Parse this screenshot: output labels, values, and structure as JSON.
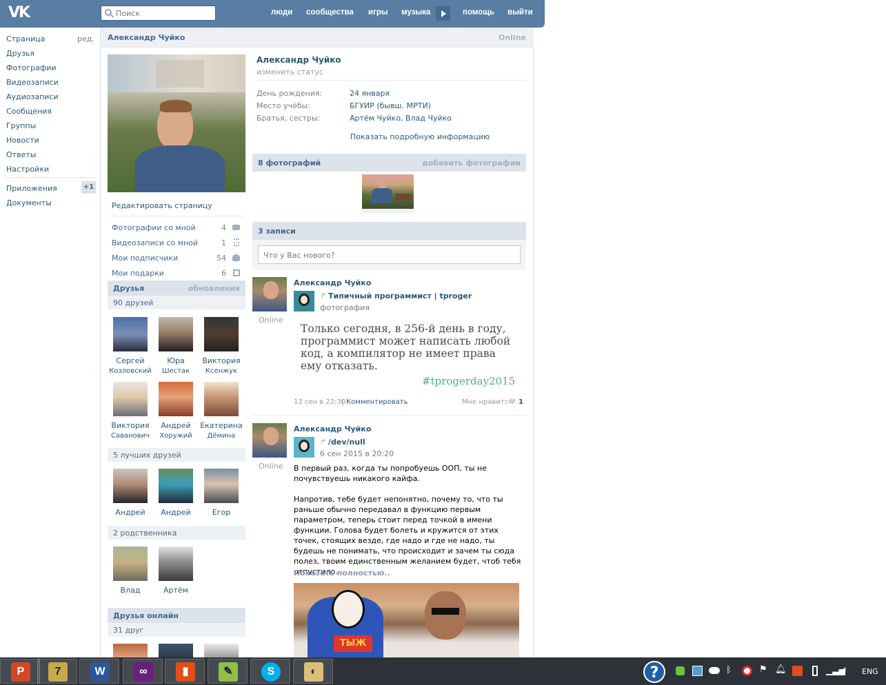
{
  "topbar": {
    "logo": "VK",
    "search_placeholder": "Поиск",
    "nav": [
      "люди",
      "сообщества",
      "игры",
      "музыка",
      "помощь",
      "выйти"
    ]
  },
  "leftnav": {
    "items": [
      "Страница",
      "Друзья",
      "Фотографии",
      "Видеозаписи",
      "Аудиозаписи",
      "Сообщения",
      "Группы",
      "Новости",
      "Ответы",
      "Настройки"
    ],
    "edit": "ред.",
    "apps": "Приложения",
    "apps_badge": "+1",
    "docs": "Документы"
  },
  "profile": {
    "header_name": "Александр Чуйко",
    "header_status": "Online",
    "name": "Александр Чуйко",
    "change_status": "изменить статус",
    "info": [
      {
        "label": "День рождения:",
        "value": "24 января"
      },
      {
        "label": "Место учёбы:",
        "value": "БГУИР (бывш. МРТИ)"
      },
      {
        "label": "Братья, сестры:",
        "value": "Артём Чуйко, Влад Чуйко"
      }
    ],
    "show_more": "Показать подробную информацию",
    "edit_page": "Редактировать страницу",
    "counters": [
      {
        "label": "Фотографии со мной",
        "count": "4",
        "icon": "camera-icon"
      },
      {
        "label": "Видеозаписи со мной",
        "count": "1",
        "icon": "film-icon"
      },
      {
        "label": "Мои подписчики",
        "count": "54",
        "icon": "people-icon"
      },
      {
        "label": "Мои подарки",
        "count": "6",
        "icon": "gift-icon"
      }
    ]
  },
  "friends": {
    "title": "Друзья",
    "updates": "обновления",
    "count": "90 друзей",
    "list": [
      {
        "first": "Сергей",
        "last": "Козловский"
      },
      {
        "first": "Юра",
        "last": "Шестак"
      },
      {
        "first": "Виктория",
        "last": "Ксенжук"
      },
      {
        "first": "Виктория",
        "last": "Саванович"
      },
      {
        "first": "Андрей",
        "last": "Хоружий"
      },
      {
        "first": "Екатерина",
        "last": "Дёмина"
      }
    ],
    "best_count": "5 лучших друзей",
    "best": [
      "Андрей",
      "Андрей",
      "Егор"
    ],
    "relatives_count": "2 родственника",
    "relatives": [
      "Влад",
      "Артём"
    ],
    "online_title": "Друзья онлайн",
    "online_count": "31 друг"
  },
  "photos": {
    "title": "8 фотографий",
    "add": "добавить фотографии"
  },
  "wall": {
    "title": "3 записи",
    "placeholder": "Что у Вас нового?",
    "posts": [
      {
        "author": "Александр Чуйко",
        "online": "Online",
        "repost_from": "Типичный программист | tproger",
        "repost_sub": "фотография",
        "image_text": "Только сегодня, в 256-й день в году, программист может написать любой код, а компилятор не имеет права ему отказать.",
        "image_tag": "#tprogerday2015",
        "date": "13 сен в 22:30",
        "comment": "Комментировать",
        "like": "Мне нравится",
        "likes": "1"
      },
      {
        "author": "Александр Чуйко",
        "online": "Online",
        "repost_from": "/dev/null",
        "repost_sub": "6 сен 2015 в 20:20",
        "text1": "В первый раз, когда ты попробуешь ООП, ты не почувствуешь никакого кайфа.",
        "text2": "Напротив, тебе будет непонятно, почему то, что ты раньше обычно передавал в функцию первым параметром, теперь стоит перед точкой в имени функции. Голова будет болеть и кружится от этих точек, стоящих везде, где надо и где не надо, ты будешь не понимать, что происходит и зачем ты сюда полез, твоим единственным желанием будет, чтоб тебя отпустило.",
        "show_full": "Показать полностью..",
        "meme_text": "ТЫЖ"
      }
    ]
  },
  "taskbar": {
    "apps": [
      "PowerPoint",
      "7-Zip",
      "Word",
      "Visual Studio",
      "Audio",
      "Notepad++",
      "Skype",
      "Paint"
    ],
    "lang": "ENG"
  }
}
